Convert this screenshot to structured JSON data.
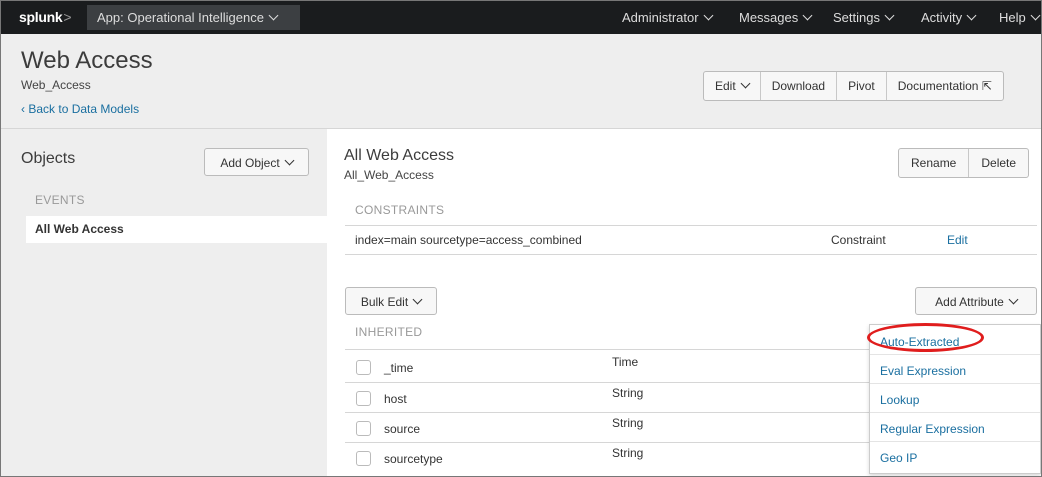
{
  "topbar": {
    "logo": "splunk",
    "logo_suffix": ">",
    "app_menu": "App: Operational Intelligence",
    "nav": [
      "Administrator",
      "Messages",
      "Settings",
      "Activity",
      "Help"
    ]
  },
  "header": {
    "title": "Web Access",
    "subtitle": "Web_Access",
    "back_link": "Back to Data Models",
    "buttons": [
      "Edit",
      "Download",
      "Pivot",
      "Documentation"
    ]
  },
  "objects_panel": {
    "title": "Objects",
    "add_button": "Add Object",
    "section": "EVENTS",
    "items": [
      "All Web Access"
    ]
  },
  "object_detail": {
    "title": "All Web Access",
    "subtitle": "All_Web_Access",
    "rename": "Rename",
    "delete": "Delete",
    "constraints_header": "CONSTRAINTS",
    "constraint": {
      "expression": "index=main sourcetype=access_combined",
      "type": "Constraint",
      "edit": "Edit"
    },
    "bulk_edit": "Bulk Edit",
    "add_attribute": "Add Attribute",
    "inherited_header": "INHERITED",
    "fields": [
      {
        "name": "_time",
        "type": "Time"
      },
      {
        "name": "host",
        "type": "String"
      },
      {
        "name": "source",
        "type": "String"
      },
      {
        "name": "sourcetype",
        "type": "String"
      }
    ]
  },
  "attribute_menu": [
    "Auto-Extracted",
    "Eval Expression",
    "Lookup",
    "Regular Expression",
    "Geo IP"
  ],
  "colors": {
    "topbar_bg": "#1a1c1e",
    "link": "#1a6fa0",
    "highlight_ring": "#e01d1d"
  }
}
